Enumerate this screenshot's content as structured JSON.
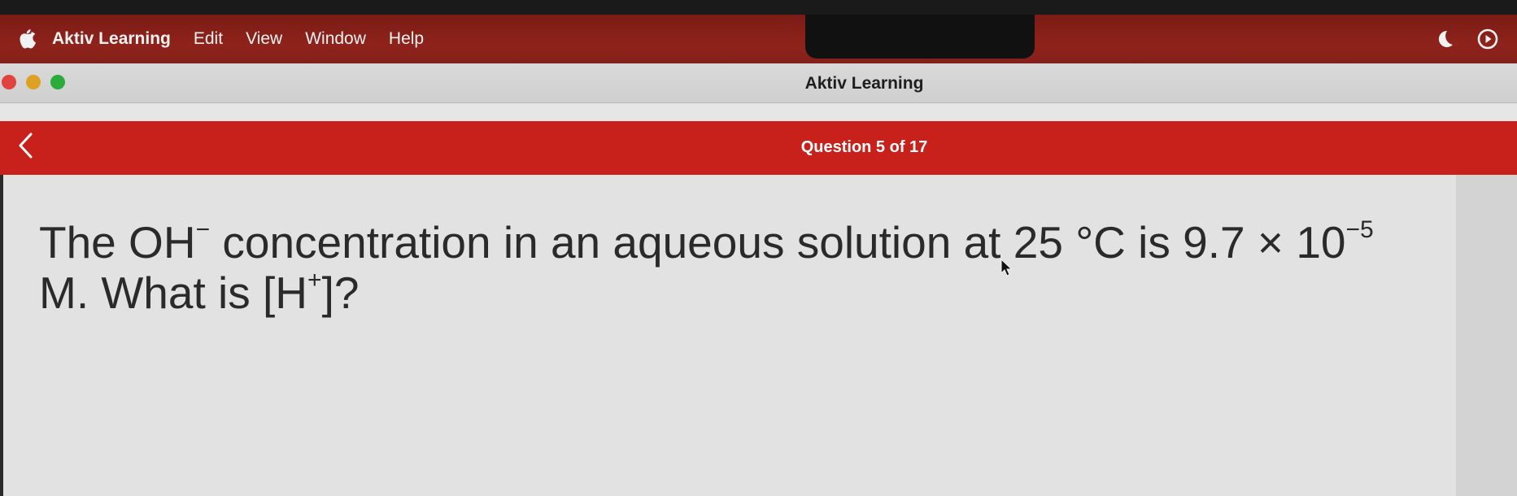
{
  "menubar": {
    "app_name": "Aktiv Learning",
    "items": [
      "Edit",
      "View",
      "Window",
      "Help"
    ],
    "icons": [
      "apple-icon",
      "moon-icon",
      "play-circle-icon"
    ]
  },
  "window": {
    "title": "Aktiv Learning",
    "traffic_lights": [
      "#e0443e",
      "#dea123",
      "#2aac3a"
    ]
  },
  "header": {
    "back_icon": "chevron-left-icon",
    "question_counter": "Question 5 of 17",
    "accent_color": "#c8211c"
  },
  "question": {
    "part1": "The OH",
    "sup1": "−",
    "part2": " concentration in an aqueous solution at 25 °C is 9.7 × 10",
    "sup2": "−5",
    "part3": "M. What is [H",
    "sup3": "+",
    "part4": "]?"
  }
}
